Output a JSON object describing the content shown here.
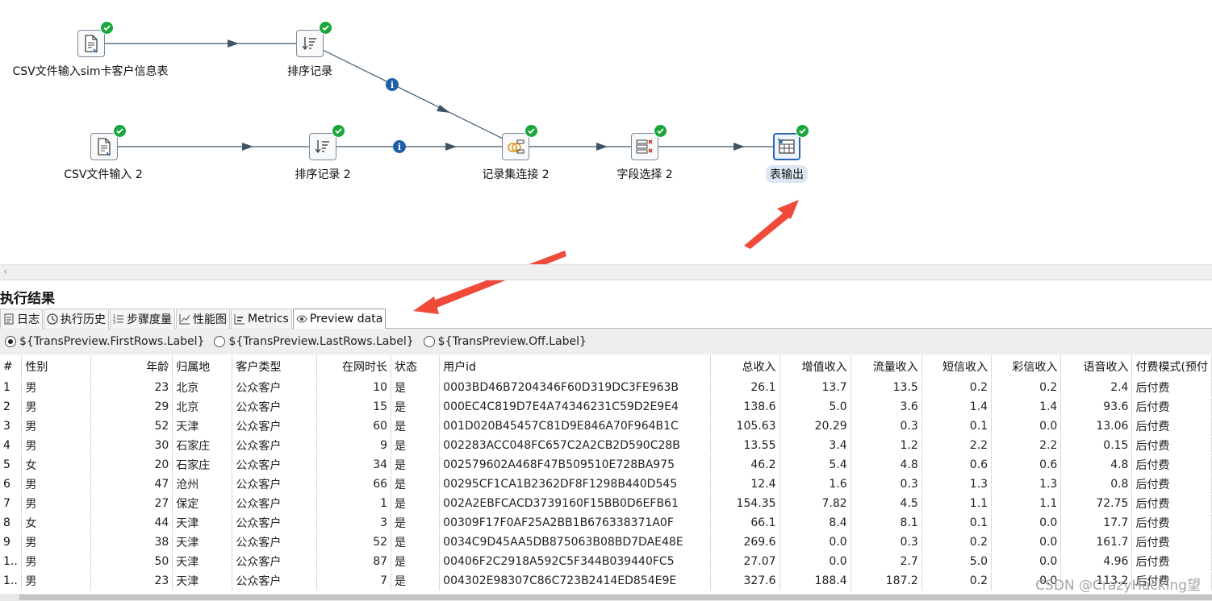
{
  "canvas": {
    "steps": {
      "csv1": {
        "label": "CSV文件输入sim卡客户信息表",
        "icon": "csv-file-icon"
      },
      "sort1": {
        "label": "排序记录",
        "icon": "sort-icon"
      },
      "csv2": {
        "label": "CSV文件输入 2",
        "icon": "csv-file-icon"
      },
      "sort2": {
        "label": "排序记录 2",
        "icon": "sort-icon"
      },
      "join": {
        "label": "记录集连接 2",
        "icon": "join-icon"
      },
      "select": {
        "label": "字段选择 2",
        "icon": "field-select-icon"
      },
      "output": {
        "label": "表输出",
        "icon": "table-output-icon"
      }
    },
    "status_icon": "check-ok-icon",
    "hop_info_glyph": "i"
  },
  "results": {
    "title": "执行结果",
    "tabs": [
      {
        "label": "日志",
        "icon": "log-icon"
      },
      {
        "label": "执行历史",
        "icon": "history-icon"
      },
      {
        "label": "步骤度量",
        "icon": "step-metrics-icon"
      },
      {
        "label": "性能图",
        "icon": "chart-icon"
      },
      {
        "label": "Metrics",
        "icon": "metrics-icon"
      },
      {
        "label": "Preview data",
        "icon": "eye-icon"
      }
    ],
    "active_tab": "Preview data",
    "preview_options": [
      {
        "label": "${TransPreview.FirstRows.Label}",
        "checked": true
      },
      {
        "label": "${TransPreview.LastRows.Label}",
        "checked": false
      },
      {
        "label": "${TransPreview.Off.Label}",
        "checked": false
      }
    ],
    "columns": [
      "#",
      "性别",
      "年龄",
      "归属地",
      "客户类型",
      "在网时长",
      "状态",
      "用户id",
      "总收入",
      "增值收入",
      "流量收入",
      "短信收入",
      "彩信收入",
      "语音收入",
      "付费模式(预付"
    ],
    "rows": [
      [
        "1",
        "男",
        "23",
        "北京",
        "公众客户",
        "10",
        "是",
        "0003BD46B7204346F60D319DC3FE963B",
        "26.1",
        "13.7",
        "13.5",
        "0.2",
        "0.2",
        "2.4",
        "后付费"
      ],
      [
        "2",
        "男",
        "29",
        "北京",
        "公众客户",
        "15",
        "是",
        "000EC4C819D7E4A74346231C59D2E9E4",
        "138.6",
        "5.0",
        "3.6",
        "1.4",
        "1.4",
        "93.6",
        "后付费"
      ],
      [
        "3",
        "男",
        "52",
        "天津",
        "公众客户",
        "60",
        "是",
        "001D020B45457C81D9E846A70F964B1C",
        "105.63",
        "20.29",
        "0.3",
        "0.1",
        "0.0",
        "13.06",
        "后付费"
      ],
      [
        "4",
        "男",
        "30",
        "石家庄",
        "公众客户",
        "9",
        "是",
        "002283ACC048FC657C2A2CB2D590C28B",
        "13.55",
        "3.4",
        "1.2",
        "2.2",
        "2.2",
        "0.15",
        "后付费"
      ],
      [
        "5",
        "女",
        "20",
        "石家庄",
        "公众客户",
        "34",
        "是",
        "002579602A468F47B509510E728BA975",
        "46.2",
        "5.4",
        "4.8",
        "0.6",
        "0.6",
        "4.8",
        "后付费"
      ],
      [
        "6",
        "男",
        "47",
        "沧州",
        "公众客户",
        "66",
        "是",
        "00295CF1CA1B2362DF8F1298B440D545",
        "12.4",
        "1.6",
        "0.3",
        "1.3",
        "1.3",
        "0.8",
        "后付费"
      ],
      [
        "7",
        "男",
        "27",
        "保定",
        "公众客户",
        "1",
        "是",
        "002A2EBFCACD3739160F15BB0D6EFB61",
        "154.35",
        "7.82",
        "4.5",
        "1.1",
        "1.1",
        "72.75",
        "后付费"
      ],
      [
        "8",
        "女",
        "44",
        "天津",
        "公众客户",
        "3",
        "是",
        "00309F17F0AF25A2BB1B676338371A0F",
        "66.1",
        "8.4",
        "8.1",
        "0.1",
        "0.0",
        "17.7",
        "后付费"
      ],
      [
        "9",
        "男",
        "38",
        "天津",
        "公众客户",
        "52",
        "是",
        "0034C9D45AA5DB875063B08BD7DAE48E",
        "269.6",
        "0.0",
        "0.3",
        "0.2",
        "0.0",
        "161.7",
        "后付费"
      ],
      [
        "1..",
        "男",
        "50",
        "天津",
        "公众客户",
        "87",
        "是",
        "00406F2C2918A592C5F344B039440FC5",
        "27.07",
        "0.0",
        "2.7",
        "5.0",
        "0.0",
        "4.96",
        "后付费"
      ],
      [
        "1..",
        "男",
        "23",
        "天津",
        "公众客户",
        "7",
        "是",
        "004302E98307C86C723B2414ED854E9E",
        "327.6",
        "188.4",
        "187.2",
        "0.2",
        "0.0",
        "113.2",
        "后付费"
      ]
    ]
  },
  "watermark": "CSDN @CrazyHacking望",
  "colors": {
    "ok": "#1aa63a",
    "info": "#1f5fa8",
    "annotation_arrow": "#f04a3a",
    "selected_border": "#2a67b3"
  }
}
